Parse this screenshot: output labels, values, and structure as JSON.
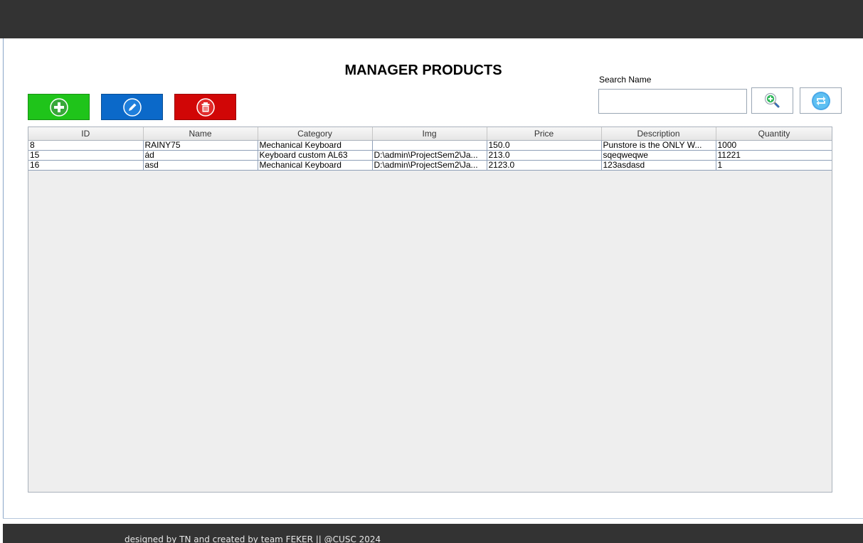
{
  "page": {
    "title": "MANAGER PRODUCTS"
  },
  "toolbar": {
    "add": {
      "icon": "plus-circle-icon",
      "color": "#1fc41a"
    },
    "edit": {
      "icon": "pencil-circle-icon",
      "color": "#0b69c9"
    },
    "delete": {
      "icon": "trash-icon",
      "color": "#d10606"
    }
  },
  "search": {
    "label": "Search Name",
    "value": "",
    "search_icon": "magnifier-plus-icon",
    "refresh_icon": "refresh-icon"
  },
  "table": {
    "columns": [
      "ID",
      "Name",
      "Category",
      "Img",
      "Price",
      "Description",
      "Quantity"
    ],
    "rows": [
      [
        "8",
        "RAINY75",
        "Mechanical Keyboard",
        "",
        "150.0",
        "Punstore is the ONLY W...",
        "1000"
      ],
      [
        "15",
        "ád",
        "Keyboard custom AL63",
        "D:\\admin\\ProjectSem2\\Ja...",
        "213.0",
        "sqeqweqwe",
        "11221"
      ],
      [
        "16",
        "asd",
        "Mechanical Keyboard",
        "D:\\admin\\ProjectSem2\\Ja...",
        "2123.0",
        "123asdasd",
        "1"
      ]
    ]
  },
  "footer": {
    "text": "designed by TN and created by team FEKER || @CUSC 2024"
  },
  "colors": {
    "topbar": "#333333",
    "footer": "#333333",
    "table_bg": "#eeeeee"
  }
}
